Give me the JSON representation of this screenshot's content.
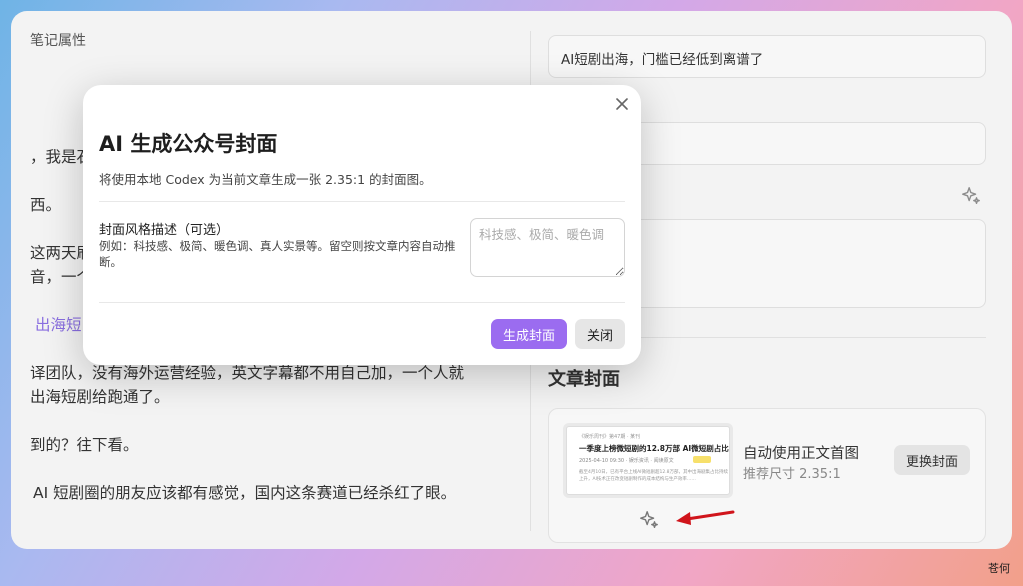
{
  "left": {
    "title": "笔记属性",
    "lines": [
      "，我是石",
      "西。",
      "这两天刷",
      "音，一个",
      "出海短",
      "译团队，没有海外运营经验，英文字幕都不用自己加，一个人就",
      "出海短剧给跑通了。",
      "到的？往下看。",
      "AI 短剧圈的朋友应该都有感觉，国内这条赛道已经杀红了眼。"
    ]
  },
  "right": {
    "title_value": "AI短剧出海，门槛已经低到离谱了",
    "cover_section_title": "文章封面",
    "cover": {
      "name": "自动使用正文首图",
      "size_hint": "推荐尺寸 2.35:1",
      "replace_label": "更换封面",
      "thumb": {
        "header": "《娱乐周刊》第47期 · 某刊",
        "title": "一季度上榜微短剧的12.8万部 AI微短剧占比超95%",
        "meta": "2025-04-10 09:30 · 娱乐资讯 · 阅读原文",
        "body": "截至4月10日，已有平台上线AI微短剧超12.8万部，其中出海剧集占比持续上升，AI技术正在改变短剧制作的成本结构与生产效率……"
      }
    },
    "arrow_color": "#d0141b"
  },
  "modal": {
    "title": "AI 生成公众号封面",
    "description": "将使用本地 Codex 为当前文章生成一张 2.35:1 的封面图。",
    "style_label": "封面风格描述（可选）",
    "style_example": "例如：科技感、极简、暖色调、真人实景等。留空则按文章内容自动推断。",
    "style_placeholder": "科技感、极简、暖色调",
    "generate_label": "生成封面",
    "close_label": "关闭",
    "accent": "#9b6cf0"
  },
  "watermark": "苍何"
}
